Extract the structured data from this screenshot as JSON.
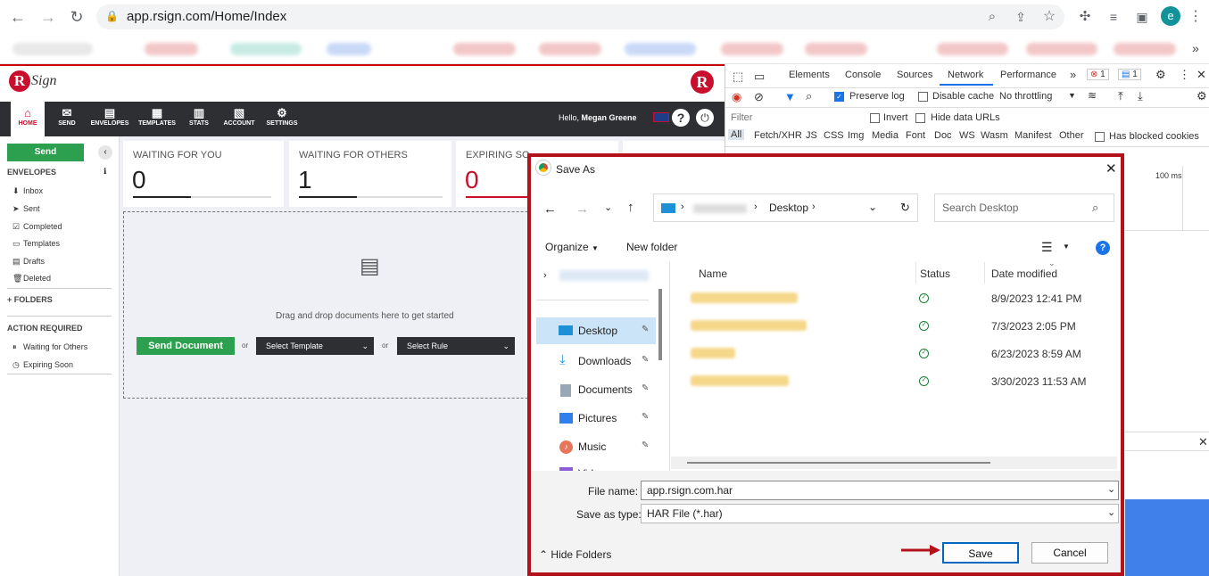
{
  "browser": {
    "url": "app.rsign.com/Home/Index",
    "profile_initial": "e"
  },
  "app": {
    "logo": "RSign",
    "logo_badge": "R",
    "nav": [
      "HOME",
      "SEND",
      "ENVELOPES",
      "TEMPLATES",
      "STATS",
      "ACCOUNT",
      "SETTINGS"
    ],
    "greeting": "Hello,",
    "user_name": "Megan Greene",
    "sidebar": {
      "send_button": "Send",
      "envelopes_heading": "ENVELOPES",
      "items": [
        "Inbox",
        "Sent",
        "Completed",
        "Templates",
        "Drafts",
        "Deleted"
      ],
      "folders": "+ FOLDERS",
      "action_heading": "ACTION REQUIRED",
      "action_items": [
        "Waiting for Others",
        "Expiring Soon"
      ]
    },
    "cards": [
      {
        "title": "WAITING FOR YOU",
        "value": "0"
      },
      {
        "title": "WAITING FOR OTHERS",
        "value": "1"
      },
      {
        "title": "EXPIRING SO",
        "value": "0"
      }
    ],
    "dropzone_text": "Drag and drop documents here to get started",
    "send_document": "Send Document",
    "or": "or",
    "select_template": "Select Template",
    "select_rule": "Select Rule"
  },
  "devtools": {
    "tabs": [
      "Elements",
      "Console",
      "Sources",
      "Network",
      "Performance"
    ],
    "errors": "1",
    "messages": "1",
    "preserve_log": "Preserve log",
    "disable_cache": "Disable cache",
    "throttling": "No throttling",
    "filter_placeholder": "Filter",
    "invert": "Invert",
    "hide_data_urls": "Hide data URLs",
    "types": [
      "All",
      "Fetch/XHR",
      "JS",
      "CSS",
      "Img",
      "Media",
      "Font",
      "Doc",
      "WS",
      "Wasm",
      "Manifest",
      "Other"
    ],
    "blocked_cookies": "Has blocked cookies",
    "timeline_label": "100 ms"
  },
  "dialog": {
    "title": "Save As",
    "breadcrumb": "Desktop",
    "search_placeholder": "Search Desktop",
    "organize": "Organize",
    "new_folder": "New folder",
    "quick_access": [
      "Desktop",
      "Downloads",
      "Documents",
      "Pictures",
      "Music",
      "Vid"
    ],
    "columns": [
      "Name",
      "Status",
      "Date modified"
    ],
    "rows": [
      {
        "date": "8/9/2023 12:41 PM"
      },
      {
        "date": "7/3/2023 2:05 PM"
      },
      {
        "date": "6/23/2023 8:59 AM"
      },
      {
        "date": "3/30/2023 11:53 AM"
      }
    ],
    "file_name_label": "File name:",
    "file_name": "app.rsign.com.har",
    "save_type_label": "Save as type:",
    "save_type": "HAR File (*.har)",
    "hide_folders": "Hide Folders",
    "save": "Save",
    "cancel": "Cancel"
  }
}
